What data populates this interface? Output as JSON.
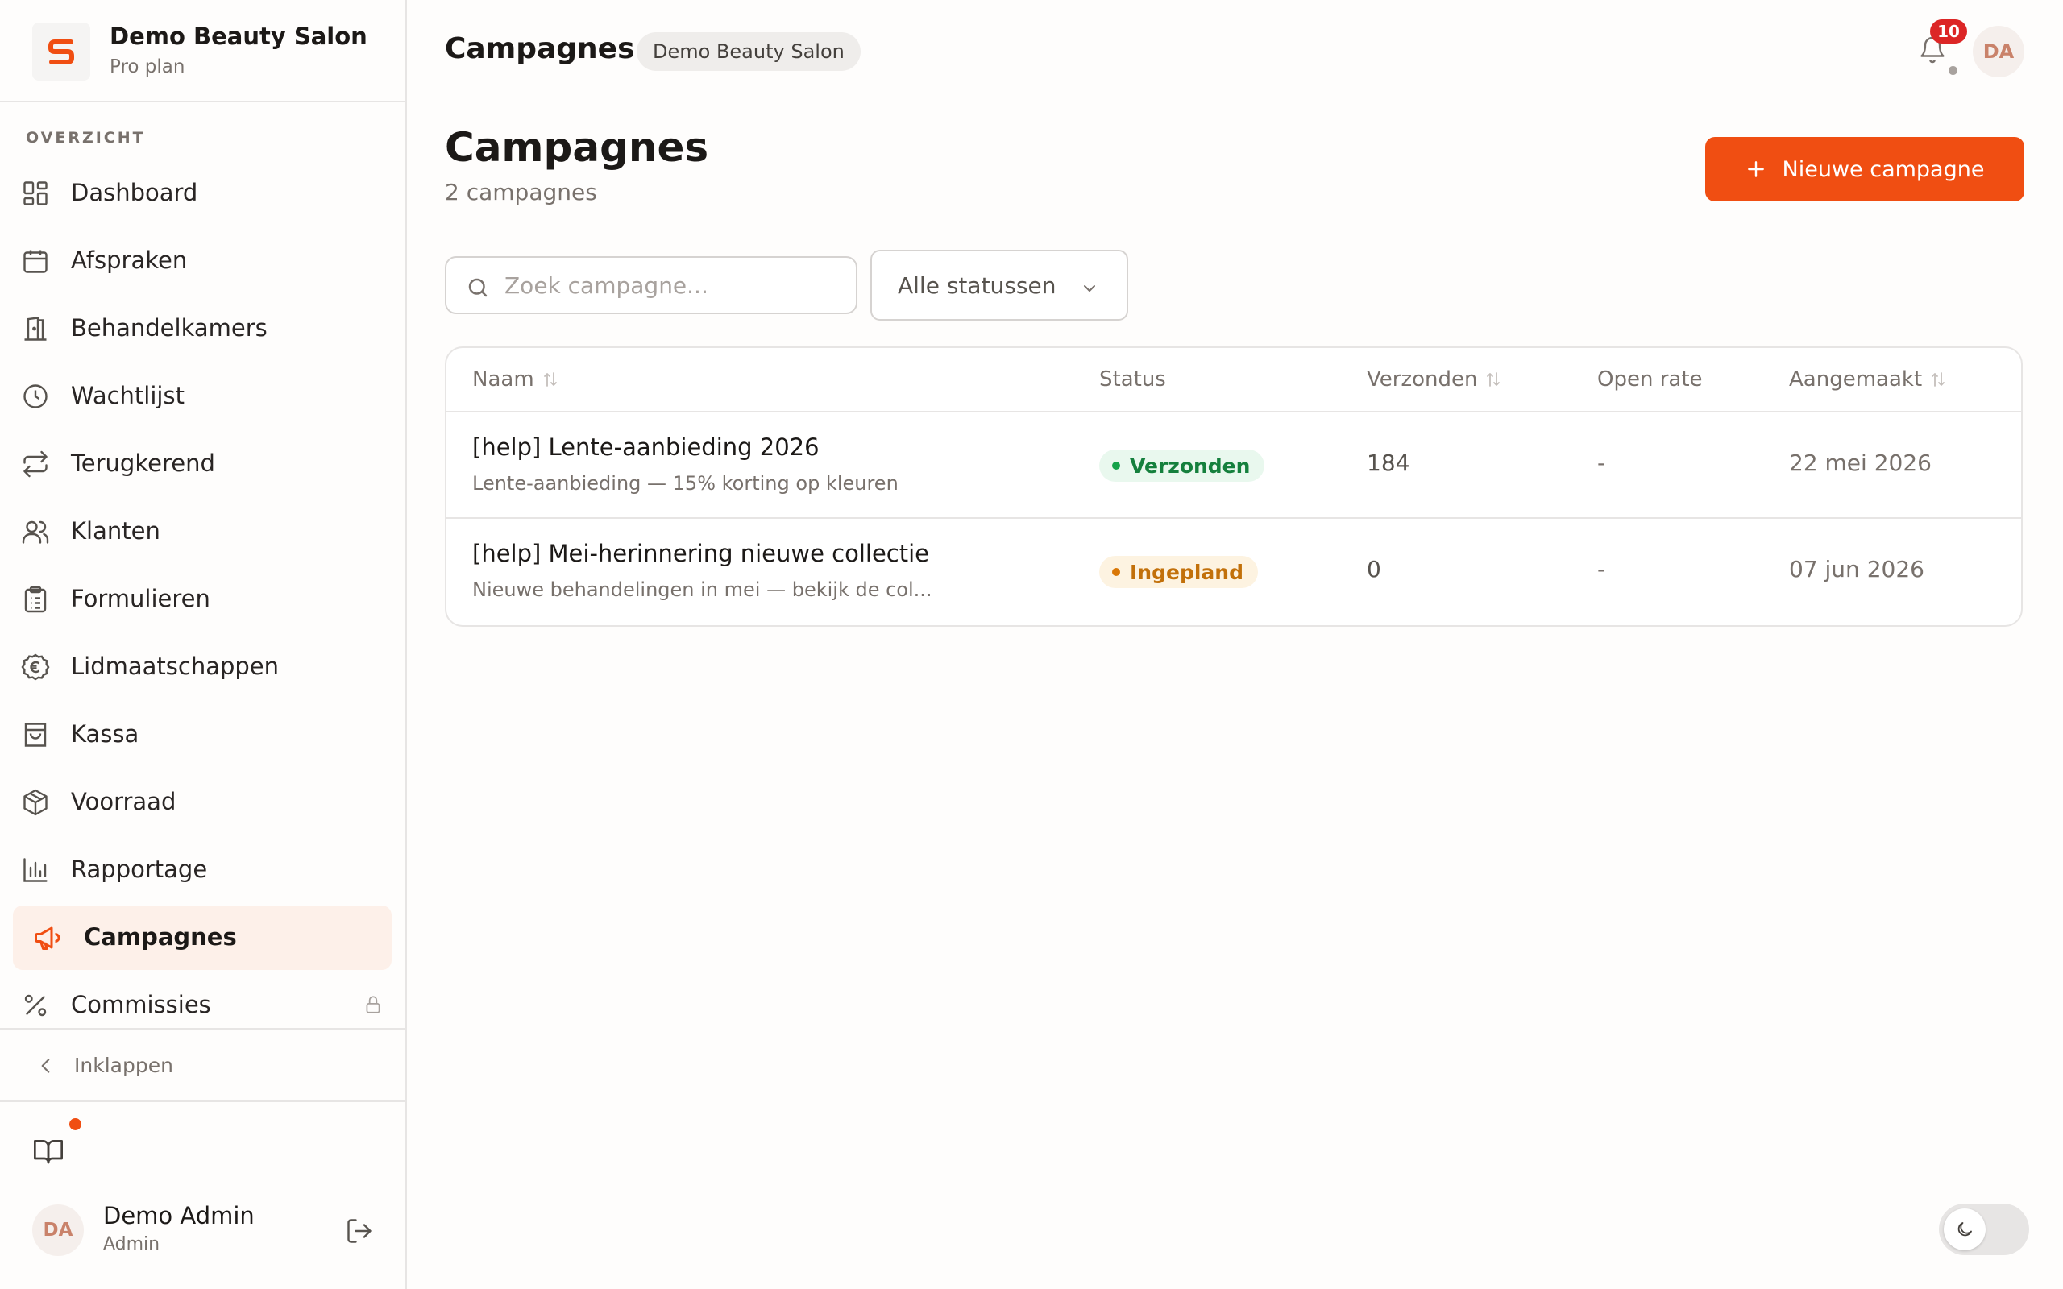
{
  "brand": {
    "name": "Demo Beauty Salon",
    "plan": "Pro plan",
    "logo_color": "#f04e12"
  },
  "sidebar": {
    "section_label": "OVERZICHT",
    "items": [
      {
        "label": "Dashboard",
        "icon": "grid-icon"
      },
      {
        "label": "Afspraken",
        "icon": "calendar-icon"
      },
      {
        "label": "Behandelkamers",
        "icon": "door-icon"
      },
      {
        "label": "Wachtlijst",
        "icon": "clock-icon"
      },
      {
        "label": "Terugkerend",
        "icon": "repeat-icon"
      },
      {
        "label": "Klanten",
        "icon": "users-icon"
      },
      {
        "label": "Formulieren",
        "icon": "clipboard-icon"
      },
      {
        "label": "Lidmaatschappen",
        "icon": "euro-coin-icon"
      },
      {
        "label": "Kassa",
        "icon": "shopping-bag-icon"
      },
      {
        "label": "Voorraad",
        "icon": "package-icon"
      },
      {
        "label": "Rapportage",
        "icon": "bar-chart-icon"
      },
      {
        "label": "Campagnes",
        "icon": "megaphone-icon",
        "active": true
      },
      {
        "label": "Commissies",
        "icon": "percent-icon",
        "locked": true
      }
    ],
    "collapse_label": "Inklappen"
  },
  "user": {
    "initials": "DA",
    "name": "Demo Admin",
    "role": "Admin"
  },
  "topbar": {
    "title": "Campagnes",
    "badge": "Demo Beauty Salon",
    "notification_count": "10",
    "avatar_initials": "DA"
  },
  "page": {
    "title": "Campagnes",
    "subtitle": "2 campagnes",
    "new_button_label": "Nieuwe campagne"
  },
  "filters": {
    "search_placeholder": "Zoek campagne...",
    "search_value": "",
    "status_selected": "Alle statussen"
  },
  "table": {
    "headers": {
      "name": "Naam",
      "status": "Status",
      "sent": "Verzonden",
      "open_rate": "Open rate",
      "created": "Aangemaakt"
    },
    "rows": [
      {
        "name": "[help] Lente-aanbieding 2026",
        "subject": "Lente-aanbieding — 15% korting op kleuren",
        "status": "Verzonden",
        "sent": "184",
        "open_rate": "-",
        "created": "22 mei 2026"
      },
      {
        "name": "[help] Mei-herinnering nieuwe collectie",
        "subject": "Nieuwe behandelingen in mei — bekijk de col...",
        "status": "Ingepland",
        "sent": "0",
        "open_rate": "-",
        "created": "07 jun 2026"
      }
    ]
  },
  "colors": {
    "accent": "#f04e12",
    "active_bg": "#fdf0e9",
    "sent_green": "#15803d",
    "scheduled_amber": "#c2700a",
    "notification_red": "#dc2626"
  }
}
